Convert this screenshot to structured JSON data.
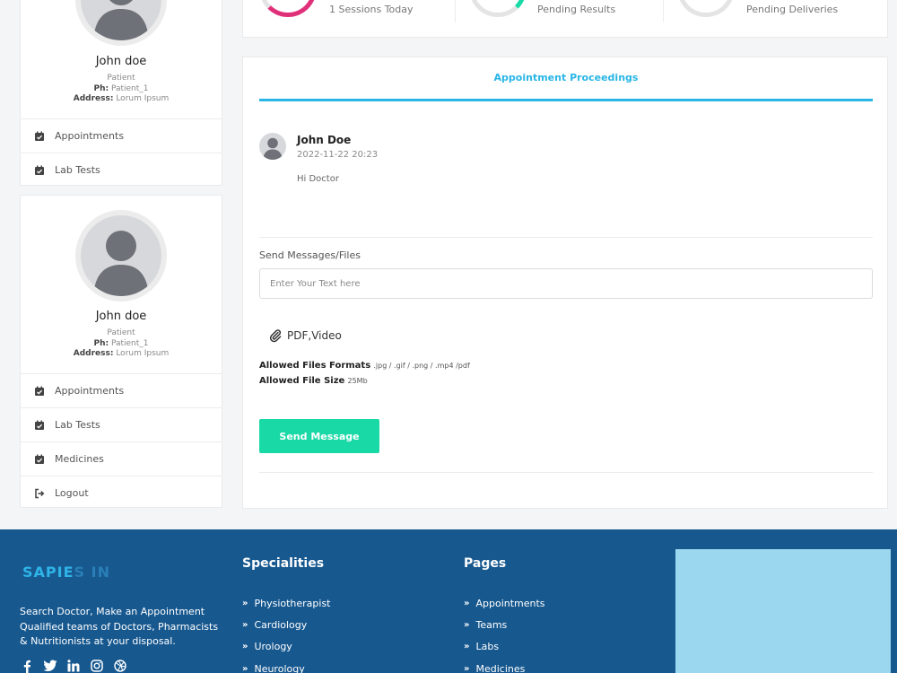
{
  "profile_cards": [
    {
      "name": "John doe",
      "role": "Patient",
      "ph_label": "Ph:",
      "ph_value": "Patient_1",
      "address_label": "Address:",
      "address_value": "Lorum Ipsum",
      "menu": [
        "Appointments",
        "Lab Tests"
      ]
    },
    {
      "name": "John doe",
      "role": "Patient",
      "ph_label": "Ph:",
      "ph_value": "Patient_1",
      "address_label": "Address:",
      "address_value": "Lorum Ipsum",
      "menu": [
        "Appointments",
        "Lab Tests",
        "Medicines",
        "Logout"
      ]
    }
  ],
  "stats": [
    {
      "label": "1 Sessions Today",
      "ring_color": "#e0307a"
    },
    {
      "label": "Pending Results",
      "ring_color": "#19d9a6"
    },
    {
      "label": "Pending Deliveries",
      "ring_color": "#555555"
    }
  ],
  "proceedings": {
    "title": "Appointment Proceedings",
    "message": {
      "author": "John Doe",
      "timestamp": "2022-11-22 20:23",
      "text": "Hi Doctor"
    },
    "send_label": "Send Messages/Files",
    "input_placeholder": "Enter Your Text here",
    "attach_label": "PDF,Video",
    "formats_label": "Allowed Files Formats",
    "formats_value": ".jpg / .gif / .png / .mp4 /pdf",
    "size_label": "Allowed File Size",
    "size_value": "25Mb",
    "send_button": "Send Message"
  },
  "footer": {
    "logo_text": "SAPIE",
    "logo_fade": "S IN",
    "about_lines": [
      "Search Doctor, Make an Appointment",
      "Qualified teams of Doctors, Pharmacists",
      "& Nutritionists at your disposal."
    ],
    "specialities_title": "Specialities",
    "specialities": [
      "Physiotherapist",
      "Cardiology",
      "Urology",
      "Neurology"
    ],
    "pages_title": "Pages",
    "pages": [
      "Appointments",
      "Teams",
      "Labs",
      "Medicines"
    ],
    "socials": [
      "facebook-icon",
      "twitter-icon",
      "linkedin-icon",
      "instagram-icon",
      "dribbble-icon"
    ]
  },
  "colors": {
    "accent": "#29b6e6",
    "button": "#19d9a6",
    "footer_bg": "#17588f"
  }
}
